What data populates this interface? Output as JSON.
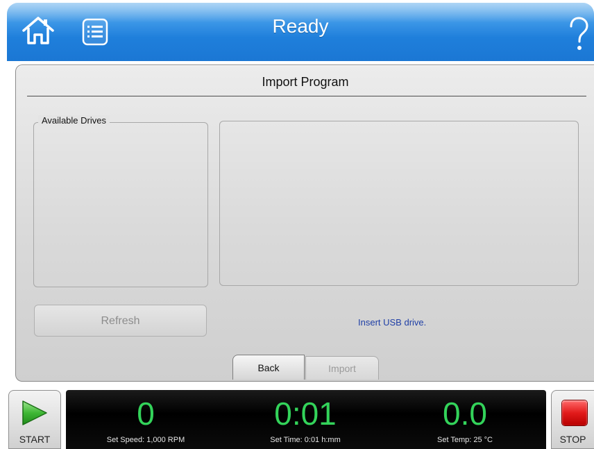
{
  "header": {
    "title": "Ready",
    "home_icon": "home-icon",
    "menu_icon": "list-menu-icon",
    "help_icon": "help-question-icon"
  },
  "panel": {
    "title": "Import Program",
    "drives_legend": "Available Drives",
    "refresh_label": "Refresh",
    "status_message": "Insert USB drive.",
    "back_label": "Back",
    "import_label": "Import"
  },
  "controls": {
    "start_label": "START",
    "stop_label": "STOP"
  },
  "readouts": [
    {
      "value": "0",
      "label": "Set Speed: 1,000 RPM"
    },
    {
      "value": "0:01",
      "label": "Set Time: 0:01 h:mm"
    },
    {
      "value": "0.0",
      "label": "Set Temp: 25 °C"
    }
  ],
  "colors": {
    "header_blue": "#1f7fdb",
    "readout_green": "#33d35a",
    "status_blue": "#1f3fa6",
    "stop_red": "#e21b1b"
  }
}
